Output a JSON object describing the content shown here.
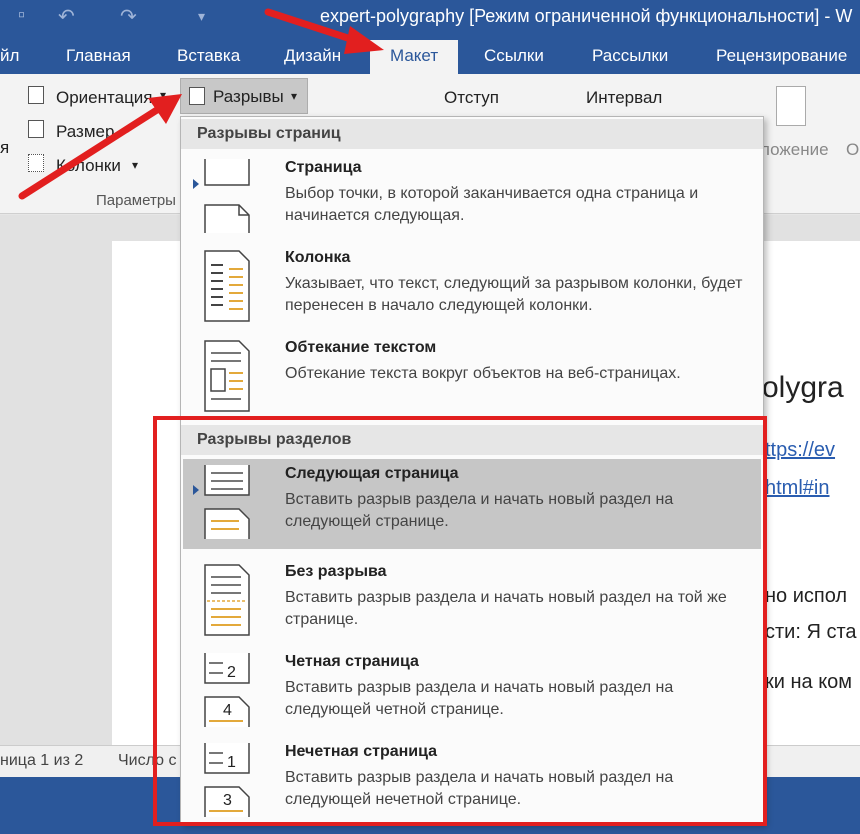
{
  "window": {
    "title": "expert-polygraphy [Режим ограниченной функциональности] - W"
  },
  "tabs": [
    {
      "label": "йл"
    },
    {
      "label": "Главная"
    },
    {
      "label": "Вставка"
    },
    {
      "label": "Дизайн"
    },
    {
      "label": "Макет"
    },
    {
      "label": "Ссылки"
    },
    {
      "label": "Рассылки"
    },
    {
      "label": "Рецензирование"
    }
  ],
  "ribbon": {
    "orientation": "Ориентация",
    "size": "Размер",
    "columns": "Колонки",
    "breaks": "Разрывы",
    "group": "Параметры",
    "indent": "Отступ",
    "spacing": "Интервал",
    "position": "ложение",
    "left_fragment": "я",
    "right_fragment": "О"
  },
  "menu": {
    "page_breaks_header": "Разрывы страниц",
    "section_breaks_header": "Разрывы разделов",
    "page_items": [
      {
        "title": "Страница",
        "desc": "Выбор точки, в которой заканчивается одна страница и начинается следующая."
      },
      {
        "title": "Колонка",
        "desc": "Указывает, что текст, следующий за разрывом колонки, будет перенесен в начало следующей колонки."
      },
      {
        "title": "Обтекание текстом",
        "desc": "Обтекание текста вокруг объектов на веб-страницах."
      }
    ],
    "section_items": [
      {
        "title": "Следующая страница",
        "desc": "Вставить разрыв раздела и начать новый раздел на следующей странице."
      },
      {
        "title": "Без разрыва",
        "desc": "Вставить разрыв раздела и начать новый раздел на той же странице."
      },
      {
        "title": "Четная страница",
        "desc": "Вставить разрыв раздела и начать новый раздел на следующей четной странице.",
        "num_top": "2",
        "num_bottom": "4"
      },
      {
        "title": "Нечетная страница",
        "desc": "Вставить разрыв раздела и начать новый раздел на следующей нечетной странице.",
        "num_top": "1",
        "num_bottom": "3"
      }
    ]
  },
  "document": {
    "line1": "olygra",
    "line2": "ttps://ev",
    "line3": "html#in",
    "line4": "но испол",
    "line5": "сти: Я ста",
    "line6": "ки на ком"
  },
  "status": {
    "page": "ница 1 из 2",
    "words": "Число с"
  },
  "colors": {
    "accent": "#2b579a",
    "highlight": "#e21f1f"
  }
}
